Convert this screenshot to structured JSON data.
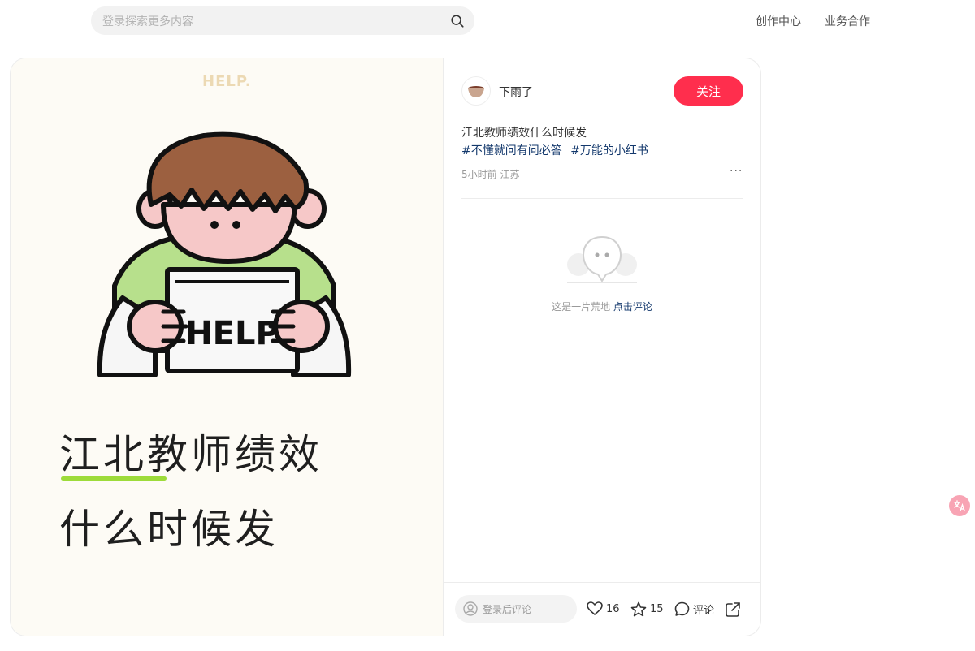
{
  "header": {
    "search_placeholder": "登录探索更多内容",
    "nav": [
      "创作中心",
      "业务合作"
    ]
  },
  "note": {
    "image_text": {
      "small": "HELP.",
      "sign": "HELP",
      "line1": "江北教师绩效",
      "line2": "什么时候发"
    },
    "author": "下雨了",
    "follow_label": "关注",
    "title": "江北教师绩效什么时候发",
    "tags": [
      "#不懂就问有问必答",
      "#万能的小红书"
    ],
    "meta": "5小时前 江苏",
    "more": "···",
    "empty": {
      "text": "这是一片荒地",
      "link": "点击评论"
    },
    "bottom": {
      "comment_placeholder": "登录后评论",
      "likes": "16",
      "collects": "15",
      "comment_label": "评论"
    }
  },
  "colors": {
    "accent": "#ff2e4d",
    "link": "#13386c",
    "highlight": "#9ddb3a"
  }
}
